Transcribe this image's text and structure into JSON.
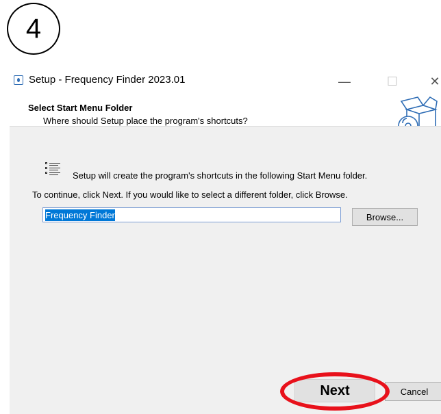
{
  "step_badge": {
    "number": "4"
  },
  "window": {
    "title": "Setup - Frequency Finder 2023.01",
    "controls": {
      "minimize": "—",
      "maximize": "☐",
      "close": "✕"
    }
  },
  "header": {
    "title": "Select Start Menu Folder",
    "subtitle": "Where should Setup place the program's shortcuts?",
    "graphic_icon": "setup-box-disc-icon"
  },
  "body": {
    "info_icon": "list-icon",
    "info_text": "Setup will create the program's shortcuts in the following Start Menu folder.",
    "instruction": "To continue, click Next. If you would like to select a different folder, click Browse.",
    "folder_value": "Frequency Finder",
    "browse_label": "Browse..."
  },
  "footer": {
    "next_label": "Next",
    "cancel_label": "Cancel"
  },
  "colors": {
    "highlight_ring": "#e8111b",
    "selection": "#0078d7",
    "icon_blue": "#2f6db5"
  }
}
